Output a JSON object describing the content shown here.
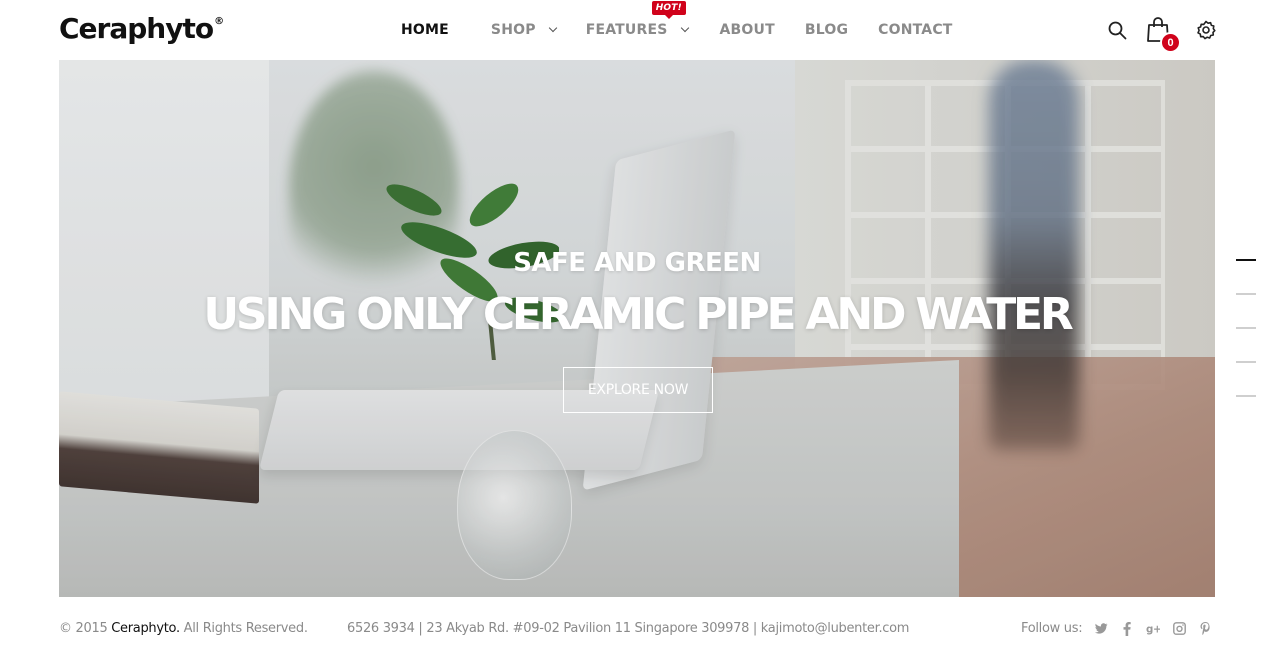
{
  "header": {
    "logo": "Ceraphyto",
    "logo_mark": "®",
    "nav": [
      {
        "label": "HOME",
        "active": true
      },
      {
        "label": "SHOP",
        "has_dropdown": true
      },
      {
        "label": "FEATURES",
        "has_dropdown": true,
        "badge": "HOT!"
      },
      {
        "label": "ABOUT"
      },
      {
        "label": "BLOG"
      },
      {
        "label": "CONTACT"
      }
    ],
    "cart_count": "0",
    "icons": [
      "search-icon",
      "shopping-bag-icon",
      "gear-icon"
    ]
  },
  "hero": {
    "subtitle": "SAFE AND GREEN",
    "title": "USING ONLY CERAMIC PIPE AND WATER",
    "button_label": "EXPLORE NOW",
    "slides_total": 5,
    "slide_active": 1
  },
  "footer": {
    "copyright_prefix": "© 2015",
    "copyright_brand": "Ceraphyto.",
    "copyright_suffix": "All Rights Reserved.",
    "contact": "6526 3934 | 23 Akyab Rd. #09-02 Pavilion 11 Singapore 309978 | kajimoto@lubenter.com",
    "follow_label": "Follow us:",
    "social": [
      "twitter-icon",
      "facebook-icon",
      "google-plus-icon",
      "instagram-icon",
      "pinterest-icon"
    ]
  },
  "colors": {
    "accent": "#d0021b",
    "text_dark": "#111111",
    "text_muted": "#8a8a8a"
  }
}
